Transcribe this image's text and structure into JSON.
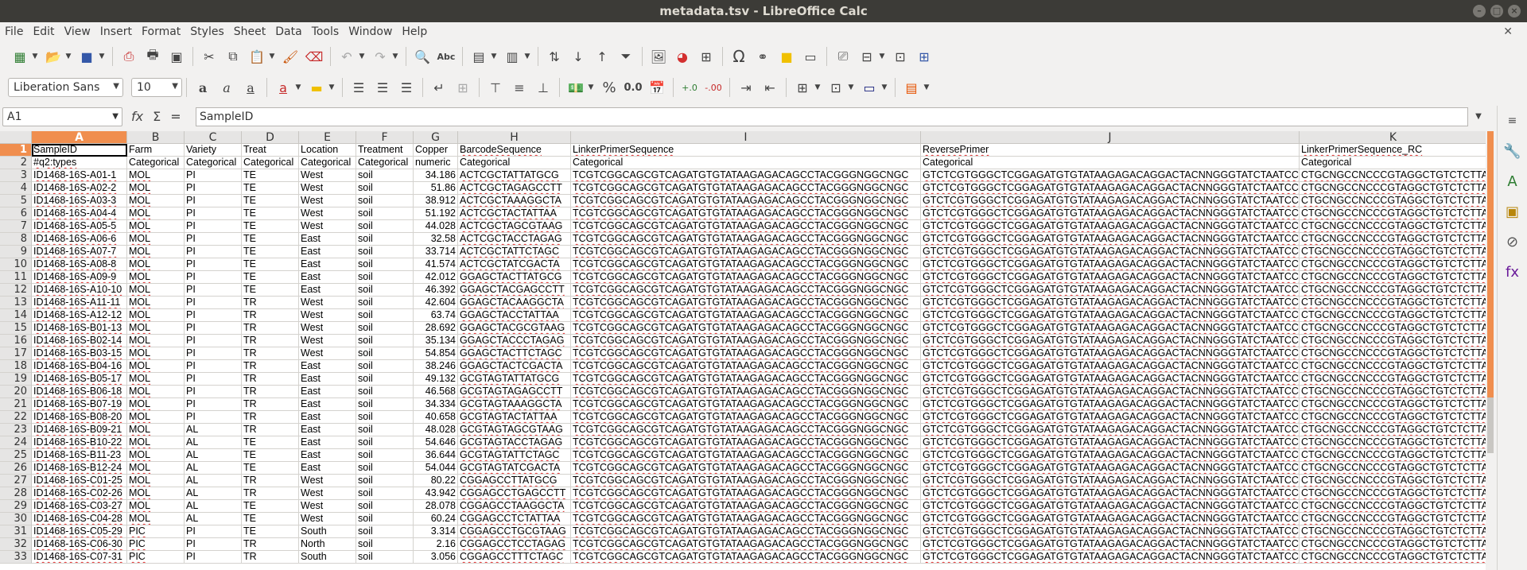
{
  "window": {
    "title": "metadata.tsv - LibreOffice Calc"
  },
  "menu": [
    "File",
    "Edit",
    "View",
    "Insert",
    "Format",
    "Styles",
    "Sheet",
    "Data",
    "Tools",
    "Window",
    "Help"
  ],
  "toolbar2": {
    "font_name": "Liberation Sans",
    "font_size": "10"
  },
  "formula_bar": {
    "cell_ref": "A1",
    "content": "SampleID"
  },
  "columns": [
    {
      "letter": "A",
      "width": 120
    },
    {
      "letter": "B",
      "width": 72
    },
    {
      "letter": "C",
      "width": 72
    },
    {
      "letter": "D",
      "width": 72
    },
    {
      "letter": "E",
      "width": 72
    },
    {
      "letter": "F",
      "width": 72
    },
    {
      "letter": "G",
      "width": 56
    },
    {
      "letter": "H",
      "width": 142
    },
    {
      "letter": "I",
      "width": 440
    },
    {
      "letter": "J",
      "width": 476
    },
    {
      "letter": "K",
      "width": 236
    }
  ],
  "rows": [
    [
      "SampleID",
      "Farm",
      "Variety",
      "Treat",
      "Location",
      "Treatment",
      "Copper",
      "BarcodeSequence",
      "LinkerPrimerSequence",
      "ReversePrimer",
      "LinkerPrimerSequence_RC"
    ],
    [
      "#q2:types",
      "Categorical",
      "Categorical",
      "Categorical",
      "Categorical",
      "Categorical",
      "numeric",
      "Categorical",
      "Categorical",
      "Categorical",
      "Categorical"
    ],
    [
      "ID1468-16S-A01-1",
      "MOL",
      "PI",
      "TE",
      "West",
      "soil",
      "34.186",
      "ACTCGCTATTATGCG",
      "TCGTCGGCAGCGTCAGATGTGTATAAGAGACAGCCTACGGGNGGCNGC",
      "GTCTCGTGGGCTCGGAGATGTGTATAAGAGACAGGACTACNNGGGTATCTAATCC",
      "CTGCNGCCNCCCGTAGGCTGTCTCTTATACA"
    ],
    [
      "ID1468-16S-A02-2",
      "MOL",
      "PI",
      "TE",
      "West",
      "soil",
      "51.86",
      "ACTCGCTAGAGCCTT",
      "TCGTCGGCAGCGTCAGATGTGTATAAGAGACAGCCTACGGGNGGCNGC",
      "GTCTCGTGGGCTCGGAGATGTGTATAAGAGACAGGACTACNNGGGTATCTAATCC",
      "CTGCNGCCNCCCGTAGGCTGTCTCTTATACA"
    ],
    [
      "ID1468-16S-A03-3",
      "MOL",
      "PI",
      "TE",
      "West",
      "soil",
      "38.912",
      "ACTCGCTAAAGGCTA",
      "TCGTCGGCAGCGTCAGATGTGTATAAGAGACAGCCTACGGGNGGCNGC",
      "GTCTCGTGGGCTCGGAGATGTGTATAAGAGACAGGACTACNNGGGTATCTAATCC",
      "CTGCNGCCNCCCGTAGGCTGTCTCTTATACA"
    ],
    [
      "ID1468-16S-A04-4",
      "MOL",
      "PI",
      "TE",
      "West",
      "soil",
      "51.192",
      "ACTCGCTACTATTAA",
      "TCGTCGGCAGCGTCAGATGTGTATAAGAGACAGCCTACGGGNGGCNGC",
      "GTCTCGTGGGCTCGGAGATGTGTATAAGAGACAGGACTACNNGGGTATCTAATCC",
      "CTGCNGCCNCCCGTAGGCTGTCTCTTATACA"
    ],
    [
      "ID1468-16S-A05-5",
      "MOL",
      "PI",
      "TE",
      "West",
      "soil",
      "44.028",
      "ACTCGCTAGCGTAAG",
      "TCGTCGGCAGCGTCAGATGTGTATAAGAGACAGCCTACGGGNGGCNGC",
      "GTCTCGTGGGCTCGGAGATGTGTATAAGAGACAGGACTACNNGGGTATCTAATCC",
      "CTGCNGCCNCCCGTAGGCTGTCTCTTATACA"
    ],
    [
      "ID1468-16S-A06-6",
      "MOL",
      "PI",
      "TE",
      "East",
      "soil",
      "32.58",
      "ACTCGCTACCTAGAG",
      "TCGTCGGCAGCGTCAGATGTGTATAAGAGACAGCCTACGGGNGGCNGC",
      "GTCTCGTGGGCTCGGAGATGTGTATAAGAGACAGGACTACNNGGGTATCTAATCC",
      "CTGCNGCCNCCCGTAGGCTGTCTCTTATACA"
    ],
    [
      "ID1468-16S-A07-7",
      "MOL",
      "PI",
      "TE",
      "East",
      "soil",
      "33.714",
      "ACTCGCTATTCTAGC",
      "TCGTCGGCAGCGTCAGATGTGTATAAGAGACAGCCTACGGGNGGCNGC",
      "GTCTCGTGGGCTCGGAGATGTGTATAAGAGACAGGACTACNNGGGTATCTAATCC",
      "CTGCNGCCNCCCGTAGGCTGTCTCTTATACA"
    ],
    [
      "ID1468-16S-A08-8",
      "MOL",
      "PI",
      "TE",
      "East",
      "soil",
      "41.574",
      "ACTCGCTATCGACTA",
      "TCGTCGGCAGCGTCAGATGTGTATAAGAGACAGCCTACGGGNGGCNGC",
      "GTCTCGTGGGCTCGGAGATGTGTATAAGAGACAGGACTACNNGGGTATCTAATCC",
      "CTGCNGCCNCCCGTAGGCTGTCTCTTATACA"
    ],
    [
      "ID1468-16S-A09-9",
      "MOL",
      "PI",
      "TE",
      "East",
      "soil",
      "42.012",
      "GGAGCTACTTATGCG",
      "TCGTCGGCAGCGTCAGATGTGTATAAGAGACAGCCTACGGGNGGCNGC",
      "GTCTCGTGGGCTCGGAGATGTGTATAAGAGACAGGACTACNNGGGTATCTAATCC",
      "CTGCNGCCNCCCGTAGGCTGTCTCTTATACA"
    ],
    [
      "ID1468-16S-A10-10",
      "MOL",
      "PI",
      "TE",
      "East",
      "soil",
      "46.392",
      "GGAGCTACGAGCCTT",
      "TCGTCGGCAGCGTCAGATGTGTATAAGAGACAGCCTACGGGNGGCNGC",
      "GTCTCGTGGGCTCGGAGATGTGTATAAGAGACAGGACTACNNGGGTATCTAATCC",
      "CTGCNGCCNCCCGTAGGCTGTCTCTTATACA"
    ],
    [
      "ID1468-16S-A11-11",
      "MOL",
      "PI",
      "TR",
      "West",
      "soil",
      "42.604",
      "GGAGCTACAAGGCTA",
      "TCGTCGGCAGCGTCAGATGTGTATAAGAGACAGCCTACGGGNGGCNGC",
      "GTCTCGTGGGCTCGGAGATGTGTATAAGAGACAGGACTACNNGGGTATCTAATCC",
      "CTGCNGCCNCCCGTAGGCTGTCTCTTATACA"
    ],
    [
      "ID1468-16S-A12-12",
      "MOL",
      "PI",
      "TR",
      "West",
      "soil",
      "63.74",
      "GGAGCTACCTATTAA",
      "TCGTCGGCAGCGTCAGATGTGTATAAGAGACAGCCTACGGGNGGCNGC",
      "GTCTCGTGGGCTCGGAGATGTGTATAAGAGACAGGACTACNNGGGTATCTAATCC",
      "CTGCNGCCNCCCGTAGGCTGTCTCTTATACA"
    ],
    [
      "ID1468-16S-B01-13",
      "MOL",
      "PI",
      "TR",
      "West",
      "soil",
      "28.692",
      "GGAGCTACGCGTAAG",
      "TCGTCGGCAGCGTCAGATGTGTATAAGAGACAGCCTACGGGNGGCNGC",
      "GTCTCGTGGGCTCGGAGATGTGTATAAGAGACAGGACTACNNGGGTATCTAATCC",
      "CTGCNGCCNCCCGTAGGCTGTCTCTTATACA"
    ],
    [
      "ID1468-16S-B02-14",
      "MOL",
      "PI",
      "TR",
      "West",
      "soil",
      "35.134",
      "GGAGCTACCCTAGAG",
      "TCGTCGGCAGCGTCAGATGTGTATAAGAGACAGCCTACGGGNGGCNGC",
      "GTCTCGTGGGCTCGGAGATGTGTATAAGAGACAGGACTACNNGGGTATCTAATCC",
      "CTGCNGCCNCCCGTAGGCTGTCTCTTATACA"
    ],
    [
      "ID1468-16S-B03-15",
      "MOL",
      "PI",
      "TR",
      "West",
      "soil",
      "54.854",
      "GGAGCTACTTCTAGC",
      "TCGTCGGCAGCGTCAGATGTGTATAAGAGACAGCCTACGGGNGGCNGC",
      "GTCTCGTGGGCTCGGAGATGTGTATAAGAGACAGGACTACNNGGGTATCTAATCC",
      "CTGCNGCCNCCCGTAGGCTGTCTCTTATACA"
    ],
    [
      "ID1468-16S-B04-16",
      "MOL",
      "PI",
      "TR",
      "East",
      "soil",
      "38.246",
      "GGAGCTACTCGACTA",
      "TCGTCGGCAGCGTCAGATGTGTATAAGAGACAGCCTACGGGNGGCNGC",
      "GTCTCGTGGGCTCGGAGATGTGTATAAGAGACAGGACTACNNGGGTATCTAATCC",
      "CTGCNGCCNCCCGTAGGCTGTCTCTTATACA"
    ],
    [
      "ID1468-16S-B05-17",
      "MOL",
      "PI",
      "TR",
      "East",
      "soil",
      "49.132",
      "GCGTAGTATTATGCG",
      "TCGTCGGCAGCGTCAGATGTGTATAAGAGACAGCCTACGGGNGGCNGC",
      "GTCTCGTGGGCTCGGAGATGTGTATAAGAGACAGGACTACNNGGGTATCTAATCC",
      "CTGCNGCCNCCCGTAGGCTGTCTCTTATACA"
    ],
    [
      "ID1468-16S-B06-18",
      "MOL",
      "PI",
      "TR",
      "East",
      "soil",
      "46.568",
      "GCGTAGTAGAGCCTT",
      "TCGTCGGCAGCGTCAGATGTGTATAAGAGACAGCCTACGGGNGGCNGC",
      "GTCTCGTGGGCTCGGAGATGTGTATAAGAGACAGGACTACNNGGGTATCTAATCC",
      "CTGCNGCCNCCCGTAGGCTGTCTCTTATACA"
    ],
    [
      "ID1468-16S-B07-19",
      "MOL",
      "PI",
      "TR",
      "East",
      "soil",
      "34.334",
      "GCGTAGTAAAGGCTA",
      "TCGTCGGCAGCGTCAGATGTGTATAAGAGACAGCCTACGGGNGGCNGC",
      "GTCTCGTGGGCTCGGAGATGTGTATAAGAGACAGGACTACNNGGGTATCTAATCC",
      "CTGCNGCCNCCCGTAGGCTGTCTCTTATACA"
    ],
    [
      "ID1468-16S-B08-20",
      "MOL",
      "PI",
      "TR",
      "East",
      "soil",
      "40.658",
      "GCGTAGTACTATTAA",
      "TCGTCGGCAGCGTCAGATGTGTATAAGAGACAGCCTACGGGNGGCNGC",
      "GTCTCGTGGGCTCGGAGATGTGTATAAGAGACAGGACTACNNGGGTATCTAATCC",
      "CTGCNGCCNCCCGTAGGCTGTCTCTTATACA"
    ],
    [
      "ID1468-16S-B09-21",
      "MOL",
      "AL",
      "TR",
      "East",
      "soil",
      "48.028",
      "GCGTAGTAGCGTAAG",
      "TCGTCGGCAGCGTCAGATGTGTATAAGAGACAGCCTACGGGNGGCNGC",
      "GTCTCGTGGGCTCGGAGATGTGTATAAGAGACAGGACTACNNGGGTATCTAATCC",
      "CTGCNGCCNCCCGTAGGCTGTCTCTTATACA"
    ],
    [
      "ID1468-16S-B10-22",
      "MOL",
      "AL",
      "TE",
      "East",
      "soil",
      "54.646",
      "GCGTAGTACCTAGAG",
      "TCGTCGGCAGCGTCAGATGTGTATAAGAGACAGCCTACGGGNGGCNGC",
      "GTCTCGTGGGCTCGGAGATGTGTATAAGAGACAGGACTACNNGGGTATCTAATCC",
      "CTGCNGCCNCCCGTAGGCTGTCTCTTATACA"
    ],
    [
      "ID1468-16S-B11-23",
      "MOL",
      "AL",
      "TE",
      "East",
      "soil",
      "36.644",
      "GCGTAGTATTCTAGC",
      "TCGTCGGCAGCGTCAGATGTGTATAAGAGACAGCCTACGGGNGGCNGC",
      "GTCTCGTGGGCTCGGAGATGTGTATAAGAGACAGGACTACNNGGGTATCTAATCC",
      "CTGCNGCCNCCCGTAGGCTGTCTCTTATACA"
    ],
    [
      "ID1468-16S-B12-24",
      "MOL",
      "AL",
      "TE",
      "East",
      "soil",
      "54.044",
      "GCGTAGTATCGACTA",
      "TCGTCGGCAGCGTCAGATGTGTATAAGAGACAGCCTACGGGNGGCNGC",
      "GTCTCGTGGGCTCGGAGATGTGTATAAGAGACAGGACTACNNGGGTATCTAATCC",
      "CTGCNGCCNCCCGTAGGCTGTCTCTTATACA"
    ],
    [
      "ID1468-16S-C01-25",
      "MOL",
      "AL",
      "TR",
      "West",
      "soil",
      "80.22",
      "CGGAGCCTTATGCG",
      "TCGTCGGCAGCGTCAGATGTGTATAAGAGACAGCCTACGGGNGGCNGC",
      "GTCTCGTGGGCTCGGAGATGTGTATAAGAGACAGGACTACNNGGGTATCTAATCC",
      "CTGCNGCCNCCCGTAGGCTGTCTCTTATACA"
    ],
    [
      "ID1468-16S-C02-26",
      "MOL",
      "AL",
      "TR",
      "West",
      "soil",
      "43.942",
      "CGGAGCCTGAGCCTT",
      "TCGTCGGCAGCGTCAGATGTGTATAAGAGACAGCCTACGGGNGGCNGC",
      "GTCTCGTGGGCTCGGAGATGTGTATAAGAGACAGGACTACNNGGGTATCTAATCC",
      "CTGCNGCCNCCCGTAGGCTGTCTCTTATACA"
    ],
    [
      "ID1468-16S-C03-27",
      "MOL",
      "AL",
      "TE",
      "West",
      "soil",
      "28.078",
      "CGGAGCCTAAGGCTA",
      "TCGTCGGCAGCGTCAGATGTGTATAAGAGACAGCCTACGGGNGGCNGC",
      "GTCTCGTGGGCTCGGAGATGTGTATAAGAGACAGGACTACNNGGGTATCTAATCC",
      "CTGCNGCCNCCCGTAGGCTGTCTCTTATACA"
    ],
    [
      "ID1468-16S-C04-28",
      "MOL",
      "AL",
      "TE",
      "West",
      "soil",
      "60.24",
      "CGGAGCCTCTATTAA",
      "TCGTCGGCAGCGTCAGATGTGTATAAGAGACAGCCTACGGGNGGCNGC",
      "GTCTCGTGGGCTCGGAGATGTGTATAAGAGACAGGACTACNNGGGTATCTAATCC",
      "CTGCNGCCNCCCGTAGGCTGTCTCTTATACA"
    ],
    [
      "ID1468-16S-C05-29",
      "PIC",
      "PI",
      "TE",
      "South",
      "soil",
      "3.314",
      "CGGAGCCTGCGTAAG",
      "TCGTCGGCAGCGTCAGATGTGTATAAGAGACAGCCTACGGGNGGCNGC",
      "GTCTCGTGGGCTCGGAGATGTGTATAAGAGACAGGACTACNNGGGTATCTAATCC",
      "CTGCNGCCNCCCGTAGGCTGTCTCTTATACA"
    ],
    [
      "ID1468-16S-C06-30",
      "PIC",
      "PI",
      "TR",
      "North",
      "soil",
      "2.16",
      "CGGAGCCTCCTAGAG",
      "TCGTCGGCAGCGTCAGATGTGTATAAGAGACAGCCTACGGGNGGCNGC",
      "GTCTCGTGGGCTCGGAGATGTGTATAAGAGACAGGACTACNNGGGTATCTAATCC",
      "CTGCNGCCNCCCGTAGGCTGTCTCTTATACA"
    ],
    [
      "ID1468-16S-C07-31",
      "PIC",
      "PI",
      "TR",
      "South",
      "soil",
      "3.056",
      "CGGAGCCTTTCTAGC",
      "TCGTCGGCAGCGTCAGATGTGTATAAGAGACAGCCTACGGGNGGCNGC",
      "GTCTCGTGGGCTCGGAGATGTGTATAAGAGACAGGACTACNNGGGTATCTAATCC",
      "CTGCNGCCNCCCGTAGGCTGTCTCTTATACA"
    ]
  ],
  "colors": {
    "accent": "#f08e4e",
    "titlebar": "#3c3b37",
    "spellcheck": "#e03030"
  }
}
